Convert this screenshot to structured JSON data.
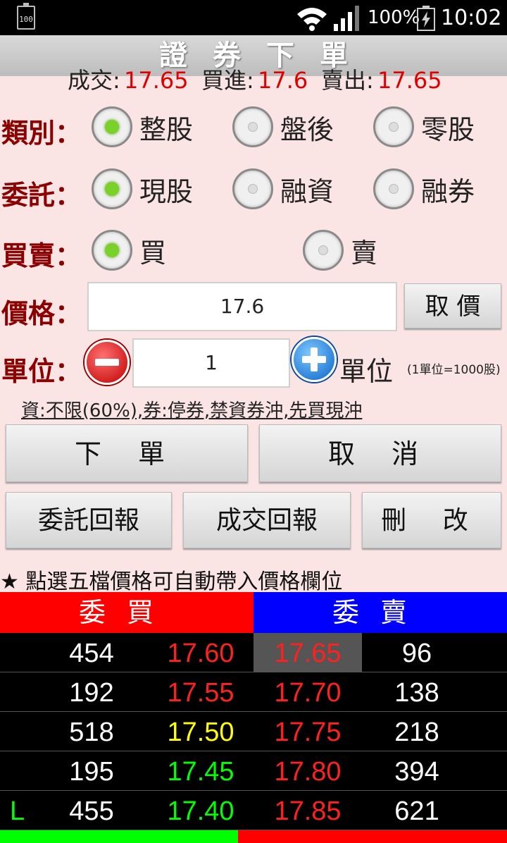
{
  "status_bar": {
    "small_battery": "100",
    "battery_pct": "100%",
    "time": "10:02"
  },
  "title": "證券下單",
  "quote": {
    "deal_label": "成交:",
    "deal_value": "17.65",
    "bid_label": "買進:",
    "bid_value": "17.6",
    "ask_label": "賣出:",
    "ask_value": "17.65"
  },
  "category": {
    "label": "類別：",
    "options": [
      "整股",
      "盤後",
      "零股"
    ],
    "selected": 0
  },
  "entrust": {
    "label": "委託：",
    "options": [
      "現股",
      "融資",
      "融券"
    ],
    "selected": 0
  },
  "side": {
    "label": "買賣：",
    "options": [
      "買",
      "賣"
    ],
    "selected": 0
  },
  "price": {
    "label": "價格：",
    "value": "17.6",
    "button": "取 價"
  },
  "unit": {
    "label": "單位：",
    "value": "1",
    "suffix": "單位",
    "hint": "(1單位=1000股)"
  },
  "margin_info": "資:不限(60%),券:停券,禁資券沖,先買現沖",
  "buttons": {
    "submit": "下 單",
    "cancel": "取 消",
    "entrust_report": "委託回報",
    "deal_report": "成交回報",
    "delete_modify": "刪 改"
  },
  "note": "★ 點選五檔價格可自動帶入價格欄位",
  "book": {
    "buy_header": "委買",
    "sell_header": "委賣",
    "rows": [
      {
        "flag": "",
        "buy_qty": "454",
        "buy_price": "17.60",
        "buy_color": "#ff2020",
        "sell_price": "17.65",
        "sell_qty": "96"
      },
      {
        "flag": "",
        "buy_qty": "192",
        "buy_price": "17.55",
        "buy_color": "#ff2020",
        "sell_price": "17.70",
        "sell_qty": "138"
      },
      {
        "flag": "",
        "buy_qty": "518",
        "buy_price": "17.50",
        "buy_color": "#ffff00",
        "sell_price": "17.75",
        "sell_qty": "218"
      },
      {
        "flag": "",
        "buy_qty": "195",
        "buy_price": "17.45",
        "buy_color": "#00ff00",
        "sell_price": "17.80",
        "sell_qty": "394"
      },
      {
        "flag": "L",
        "buy_qty": "455",
        "buy_price": "17.40",
        "buy_color": "#00ff00",
        "sell_price": "17.85",
        "sell_qty": "621"
      }
    ],
    "sell_color": "#ff2020",
    "highlight_sell_row": 0
  },
  "colors": {
    "label": "#8b0000",
    "quote_value": "#e00000",
    "buy_header": "#ff0000",
    "sell_header": "#0000ff"
  }
}
